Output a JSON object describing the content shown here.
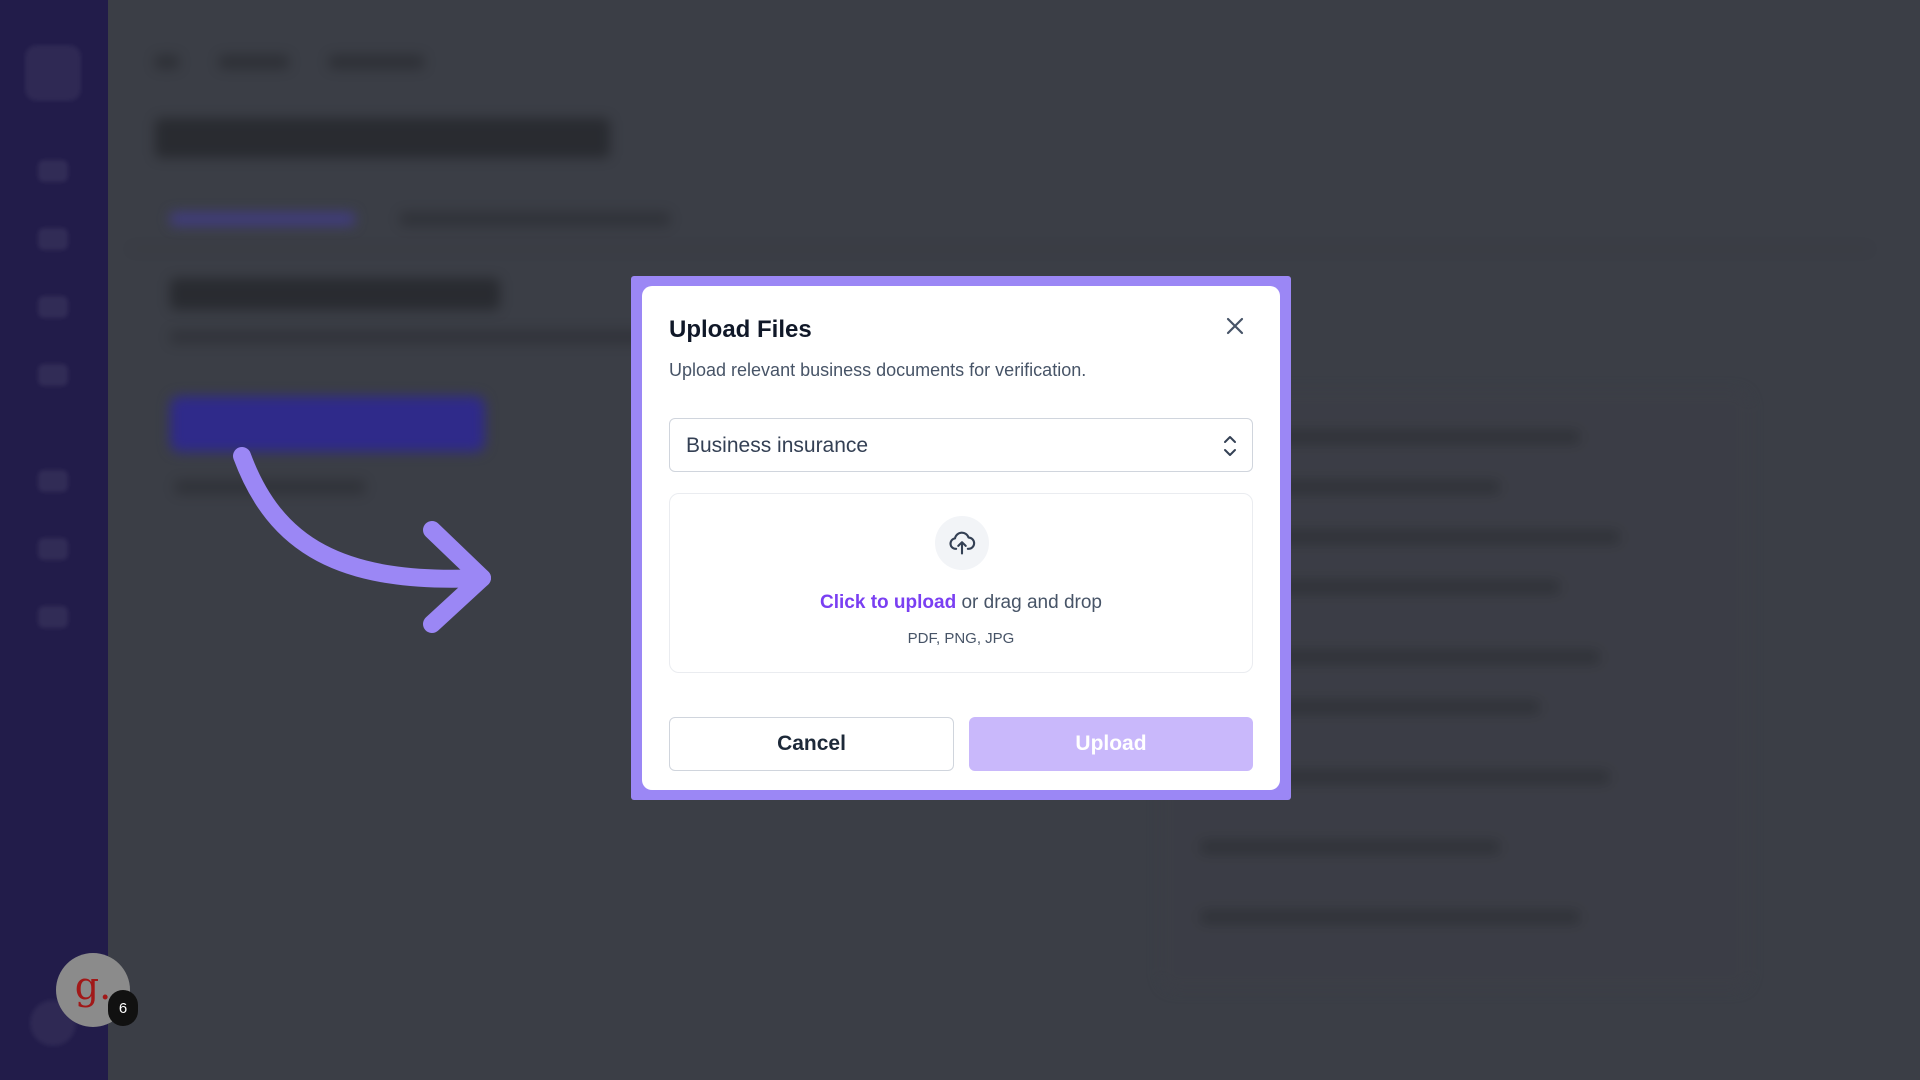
{
  "modal": {
    "title": "Upload Files",
    "description": "Upload relevant business documents for verification.",
    "close_icon": "close-icon",
    "document_type": {
      "selected": "Business insurance",
      "icon": "chevron-up-down-icon"
    },
    "dropzone": {
      "icon": "cloud-upload-icon",
      "link_text": "Click to upload",
      "rest_text": " or drag and drop",
      "file_types": "PDF, PNG, JPG"
    },
    "cancel_label": "Cancel",
    "upload_label": "Upload"
  },
  "annotation": {
    "arrow_icon": "curved-arrow-icon",
    "frame_color": "#9b87f5"
  },
  "avatar": {
    "letter": "g.",
    "badge_count": "6"
  },
  "colors": {
    "accent": "#7a3ff2",
    "upload_button_disabled": "#c9b8fb",
    "sidebar": "#221c4a"
  }
}
